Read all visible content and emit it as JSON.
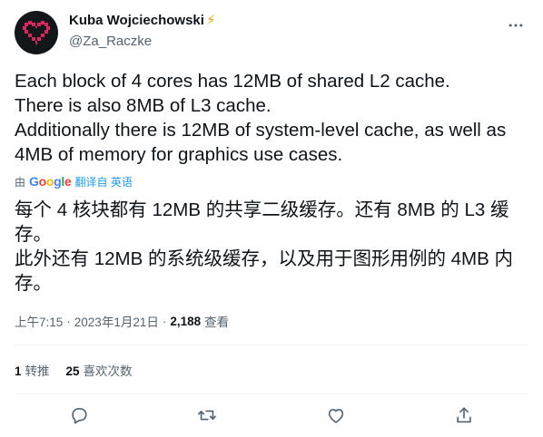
{
  "author": {
    "display_name": "Kuba Wojciechowski",
    "badge": "⚡",
    "handle": "@Za_Raczke"
  },
  "tweet": {
    "lines": [
      "Each block of 4 cores has 12MB of shared L2 cache.",
      "There is also 8MB of L3 cache.",
      "Additionally there is 12MB of system-level cache, as well as 4MB of memory for graphics use cases."
    ]
  },
  "translation": {
    "by_label": "由",
    "provider_letters": [
      "G",
      "o",
      "o",
      "g",
      "l",
      "e"
    ],
    "link_label": "翻译自 英语",
    "lines": [
      "每个 4 核块都有 12MB 的共享二级缓存。还有 8MB 的 L3 缓存。",
      "此外还有 12MB 的系统级缓存，以及用于图形用例的 4MB 内存。"
    ]
  },
  "meta": {
    "time": "上午7:15",
    "dot": "·",
    "date": "2023年1月21日",
    "views_count": "2,188",
    "views_label": "查看"
  },
  "stats": {
    "retweets_count": "1",
    "retweets_label": "转推",
    "likes_count": "25",
    "likes_label": "喜欢次数"
  },
  "icons": {
    "avatar": "heart-pixel-icon",
    "more": "more-icon",
    "reply": "reply-icon",
    "retweet": "retweet-icon",
    "like": "like-icon",
    "share": "share-icon"
  },
  "colors": {
    "text": "#0f1419",
    "secondary": "#536471",
    "link": "#1d9bf0",
    "avatar_heart": "#e0245e",
    "badge": "#f4a100",
    "divider": "#eff3f4"
  }
}
